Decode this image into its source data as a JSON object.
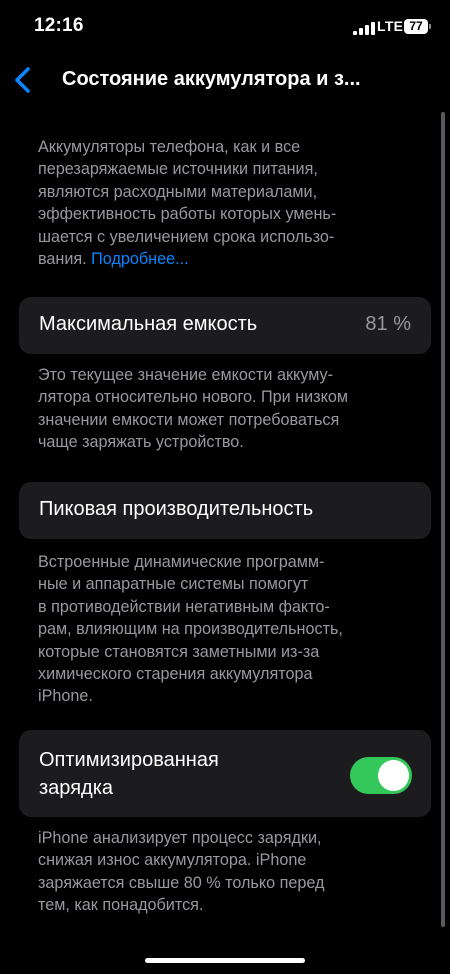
{
  "status_bar": {
    "time": "12:16",
    "network": "LTE",
    "battery_level": "77"
  },
  "nav": {
    "title": "Состояние аккумулятора и з..."
  },
  "intro": {
    "lines": [
      "Аккумуляторы телефона, как и все",
      "перезаряжаемые источники питания,",
      "являются расходными материалами,",
      "эффективность работы которых умень-",
      "шается с увеличением срока использо-",
      "вания."
    ],
    "link": "Подробнее..."
  },
  "max_capacity": {
    "label": "Максимальная емкость",
    "value": "81 %",
    "footer_lines": [
      "Это текущее значение емкости аккуму-",
      "лятора относительно нового. При низком",
      "значении емкости может потребоваться",
      "чаще заряжать устройство."
    ]
  },
  "peak_performance": {
    "label": "Пиковая производительность",
    "footer_lines": [
      "Встроенные динамические программ-",
      "ные и аппаратные системы помогут",
      "в противодействии негативным факто-",
      "рам, влияющим на производительность,",
      "которые становятся заметными из-за",
      "химического старения аккумулятора",
      "iPhone."
    ]
  },
  "optimized_charging": {
    "label_lines": [
      "Оптимизированная",
      "зарядка"
    ],
    "enabled": true,
    "footer_lines": [
      "iPhone анализирует процесс зарядки,",
      "снижая износ аккумулятора. iPhone",
      "заряжается свыше 80 % только перед",
      "тем, как понадобится."
    ]
  },
  "colors": {
    "accent": "#0a84ff",
    "toggle_on": "#34c759",
    "cell_background": "#1c1c1e",
    "secondary_text": "#98989f"
  }
}
